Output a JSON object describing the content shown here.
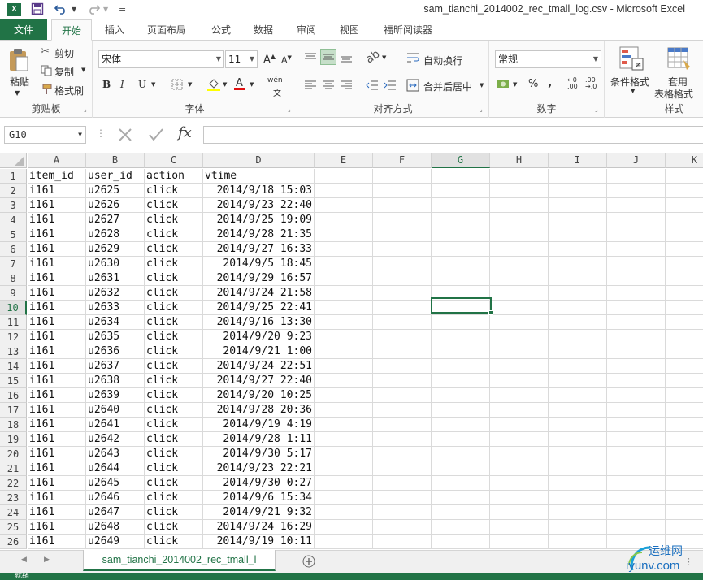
{
  "titlebar": {
    "app_badge": "X",
    "title": "sam_tianchi_2014002_rec_tmall_log.csv - Microsoft Excel",
    "qa_more": "="
  },
  "tabs": [
    "文件",
    "开始",
    "插入",
    "页面布局",
    "公式",
    "数据",
    "审阅",
    "视图",
    "福昕阅读器"
  ],
  "ribbon": {
    "clipboard": {
      "paste": "粘贴",
      "cut": "剪切",
      "copy": "复制",
      "format_painter": "格式刷",
      "label": "剪贴板"
    },
    "font": {
      "name": "宋体",
      "size": "11",
      "bold": "B",
      "italic": "I",
      "underline": "U",
      "phonetic": "wén",
      "label": "字体"
    },
    "alignment": {
      "wrap": "自动换行",
      "merge": "合并后居中",
      "label": "对齐方式"
    },
    "number": {
      "format": "常规",
      "percent": "%",
      "comma": ",",
      "label": "数字"
    },
    "styles": {
      "conditional": "条件格式",
      "table1": "套用",
      "table2": "表格格式",
      "label": "样式"
    }
  },
  "formula_bar": {
    "name_box": "G10",
    "fx": "fx",
    "content": ""
  },
  "columns": [
    "A",
    "B",
    "C",
    "D",
    "E",
    "F",
    "G",
    "H",
    "I",
    "J",
    "K"
  ],
  "selected_column": "G",
  "selected_row": 10,
  "rows": [
    [
      "item_id",
      "user_id",
      "action",
      "vtime"
    ],
    [
      "i161",
      "u2625",
      "click",
      "2014/9/18 15:03"
    ],
    [
      "i161",
      "u2626",
      "click",
      "2014/9/23 22:40"
    ],
    [
      "i161",
      "u2627",
      "click",
      "2014/9/25 19:09"
    ],
    [
      "i161",
      "u2628",
      "click",
      "2014/9/28 21:35"
    ],
    [
      "i161",
      "u2629",
      "click",
      "2014/9/27 16:33"
    ],
    [
      "i161",
      "u2630",
      "click",
      "2014/9/5 18:45"
    ],
    [
      "i161",
      "u2631",
      "click",
      "2014/9/29 16:57"
    ],
    [
      "i161",
      "u2632",
      "click",
      "2014/9/24 21:58"
    ],
    [
      "i161",
      "u2633",
      "click",
      "2014/9/25 22:41"
    ],
    [
      "i161",
      "u2634",
      "click",
      "2014/9/16 13:30"
    ],
    [
      "i161",
      "u2635",
      "click",
      "2014/9/20 9:23"
    ],
    [
      "i161",
      "u2636",
      "click",
      "2014/9/21 1:00"
    ],
    [
      "i161",
      "u2637",
      "click",
      "2014/9/24 22:51"
    ],
    [
      "i161",
      "u2638",
      "click",
      "2014/9/27 22:40"
    ],
    [
      "i161",
      "u2639",
      "click",
      "2014/9/20 10:25"
    ],
    [
      "i161",
      "u2640",
      "click",
      "2014/9/28 20:36"
    ],
    [
      "i161",
      "u2641",
      "click",
      "2014/9/19 4:19"
    ],
    [
      "i161",
      "u2642",
      "click",
      "2014/9/28 1:11"
    ],
    [
      "i161",
      "u2643",
      "click",
      "2014/9/30 5:17"
    ],
    [
      "i161",
      "u2644",
      "click",
      "2014/9/23 22:21"
    ],
    [
      "i161",
      "u2645",
      "click",
      "2014/9/30 0:27"
    ],
    [
      "i161",
      "u2646",
      "click",
      "2014/9/6 15:34"
    ],
    [
      "i161",
      "u2647",
      "click",
      "2014/9/21 9:32"
    ],
    [
      "i161",
      "u2648",
      "click",
      "2014/9/24 16:29"
    ],
    [
      "i161",
      "u2649",
      "click",
      "2014/9/19 10:11"
    ]
  ],
  "sheet_tab": "sam_tianchi_2014002_rec_tmall_l",
  "status": "就绪",
  "watermark": {
    "cn": "运维网",
    "en": "iyunv.com"
  },
  "colors": {
    "accent": "#217346"
  }
}
